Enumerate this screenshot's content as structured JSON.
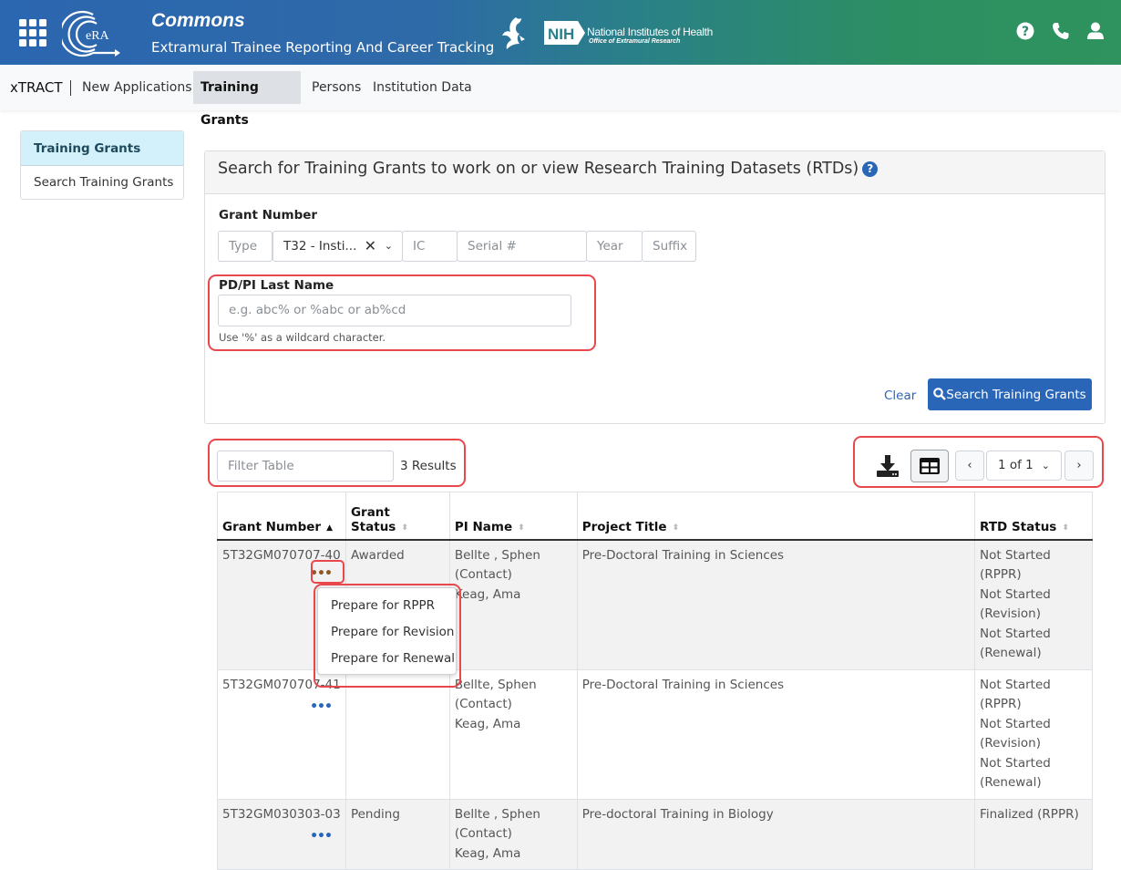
{
  "header": {
    "app_title": "Commons",
    "app_subtitle": "Extramural Trainee Reporting And Career Tracking",
    "era_logo_text": "eRA",
    "nih_badge": "NIH",
    "nih_name": "National Institutes of Health",
    "nih_office": "Office of Extramural Research",
    "icons": [
      "apps-grid-icon",
      "help-icon",
      "phone-icon",
      "user-icon"
    ]
  },
  "nav": {
    "brand": "xTRACT",
    "items": [
      {
        "label": "New Applications",
        "active": false
      },
      {
        "label": "Training Grants",
        "active": true
      },
      {
        "label": "Persons",
        "active": false
      },
      {
        "label": "Institution Data",
        "active": false
      }
    ]
  },
  "sidebar": {
    "heading": "Training Grants",
    "items": [
      {
        "label": "Search Training Grants"
      }
    ]
  },
  "search": {
    "title": "Search for Training Grants to work on or view Research Training Datasets (RTDs)",
    "help_glyph": "?",
    "grant_number_label": "Grant Number",
    "type_placeholder": "Type",
    "activity_value": "T32 - Insti...",
    "clear_glyph": "✕",
    "chevron_glyph": "⌄",
    "ic_placeholder": "IC",
    "serial_placeholder": "Serial #",
    "year_placeholder": "Year",
    "suffix_placeholder": "Suffix",
    "pi_label": "PD/PI Last Name",
    "pi_placeholder": "e.g. abc% or %abc or ab%cd",
    "pi_hint": "Use '%' as a wildcard character.",
    "clear_label": "Clear",
    "search_label": "Search Training Grants"
  },
  "toolbar": {
    "filter_placeholder": "Filter Table",
    "results_text": "3 Results",
    "page_select": "1 of 1",
    "prev_glyph": "‹",
    "next_glyph": "›"
  },
  "table": {
    "columns": [
      "Grant Number",
      "Grant Status",
      "PI Name",
      "Project Title",
      "RTD Status"
    ],
    "grant_status_line1": "Grant",
    "grant_status_line2": "Status",
    "rows": [
      {
        "grant_number": "5T32GM070707-40",
        "grant_status": "Awarded",
        "pi_name": [
          "Bellte , Sphen",
          "(Contact)",
          "Keag, Ama"
        ],
        "project_title": "Pre-Doctoral Training in Sciences",
        "rtd_status": [
          "Not Started (RPPR)",
          "Not Started (Revision)",
          "Not Started (Renewal)"
        ]
      },
      {
        "grant_number": "5T32GM070707-41",
        "grant_status": "",
        "pi_name": [
          "Bellte, Sphen",
          "(Contact)",
          "Keag, Ama"
        ],
        "project_title": "Pre-Doctoral Training in Sciences",
        "rtd_status": [
          "Not Started (RPPR)",
          "Not Started (Revision)",
          "Not Started (Renewal)"
        ]
      },
      {
        "grant_number": "5T32GM030303-03",
        "grant_status": "Pending",
        "pi_name": [
          "Bellte , Sphen",
          "(Contact)",
          "Keag, Ama"
        ],
        "project_title": "Pre-doctoral Training in Biology",
        "rtd_status": [
          "Finalized (RPPR)"
        ]
      }
    ],
    "actions_glyph": "•••"
  },
  "row_menu": {
    "items": [
      "Prepare for RPPR",
      "Prepare for Revision",
      "Prepare for Renewal"
    ]
  },
  "colors": {
    "primary": "#2a66b8",
    "callout": "#e8474c",
    "sidebar_active": "#d3f1fb"
  }
}
